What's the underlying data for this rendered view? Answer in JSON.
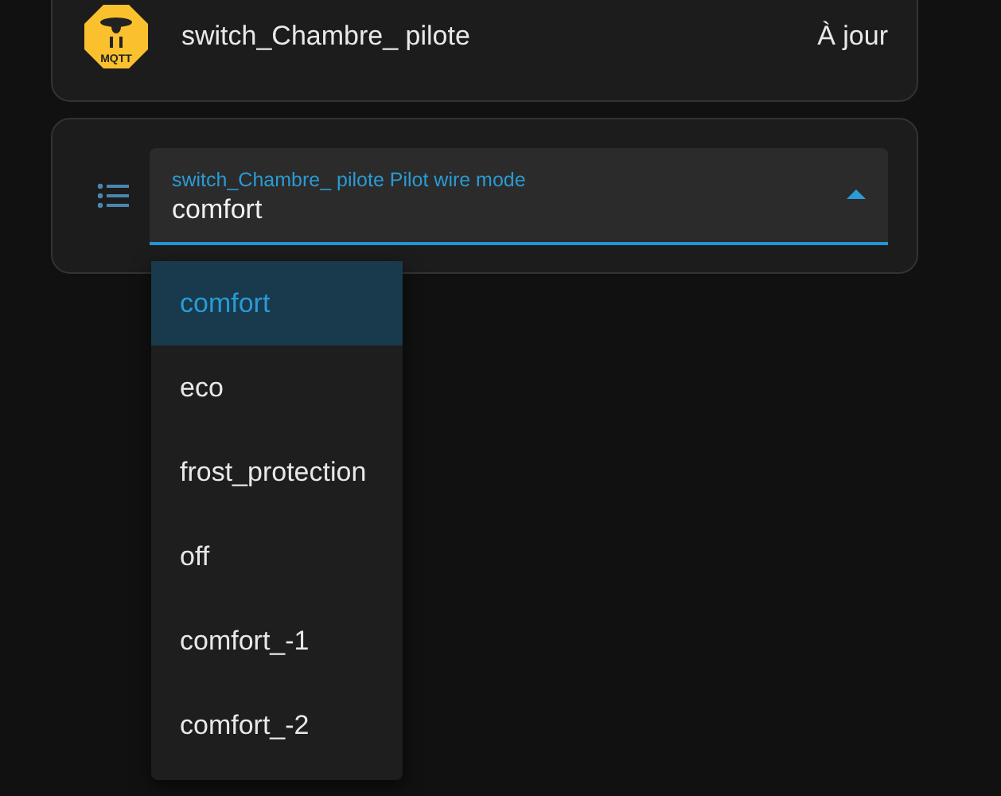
{
  "device": {
    "logo_text": "MQTT",
    "name": "switch_Chambre_ pilote",
    "status": "À jour"
  },
  "select": {
    "label": "switch_Chambre_ pilote Pilot wire mode",
    "value": "comfort",
    "expanded": true
  },
  "options": [
    {
      "label": "comfort",
      "selected": true
    },
    {
      "label": "eco",
      "selected": false
    },
    {
      "label": "frost_protection",
      "selected": false
    },
    {
      "label": "off",
      "selected": false
    },
    {
      "label": "comfort_-1",
      "selected": false
    },
    {
      "label": "comfort_-2",
      "selected": false
    }
  ]
}
